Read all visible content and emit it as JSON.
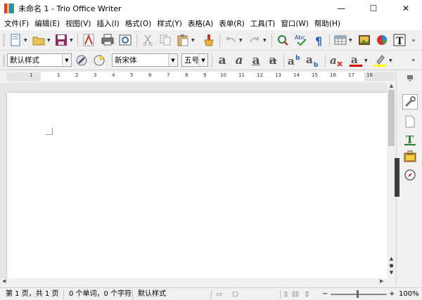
{
  "window": {
    "title": "未命名 1 - Trio Office Writer",
    "min_glyph": "—",
    "max_glyph": "☐",
    "close_glyph": "✕"
  },
  "menu": [
    "文件(F)",
    "编辑(E)",
    "视图(V)",
    "插入(I)",
    "格式(O)",
    "样式(Y)",
    "表格(A)",
    "表单(R)",
    "工具(T)",
    "窗口(W)",
    "帮助(H)"
  ],
  "format_bar": {
    "paragraph_style": "默认样式",
    "font_name": "新宋体",
    "font_size": "五号"
  },
  "ruler": {
    "numbers": [
      "1",
      "1",
      "2",
      "3",
      "4",
      "5",
      "6",
      "7",
      "8",
      "9",
      "10",
      "11",
      "12",
      "13",
      "14",
      "15",
      "16",
      "17",
      "18"
    ]
  },
  "status": {
    "page_info": "第 1 页，共 1 页",
    "word_count": "0 个单词，0 个字符",
    "style": "默认样式",
    "zoom": "100%"
  },
  "colors": {
    "title_bg": "#ffffff",
    "toolbar_bg": "#f0f0f0",
    "doc_bg": "#e6e6e6",
    "font_color_underline": "#d40000",
    "highlight_color": "#ffff00"
  },
  "icons": {
    "new_doc": "new-document-icon",
    "open": "open-folder-icon",
    "save": "save-icon",
    "pdf": "export-pdf-icon",
    "print": "print-icon",
    "preview": "print-preview-icon",
    "cut": "cut-icon",
    "copy": "copy-icon",
    "paste": "paste-icon",
    "clone": "clone-format-icon",
    "undo": "undo-icon",
    "redo": "redo-icon",
    "navigator": "navigator-icon",
    "spell": "spellcheck-icon",
    "marks": "formatting-marks-icon",
    "table": "insert-table-icon",
    "image": "insert-image-icon",
    "chart": "insert-chart-icon",
    "textbox": "text-box-icon"
  }
}
